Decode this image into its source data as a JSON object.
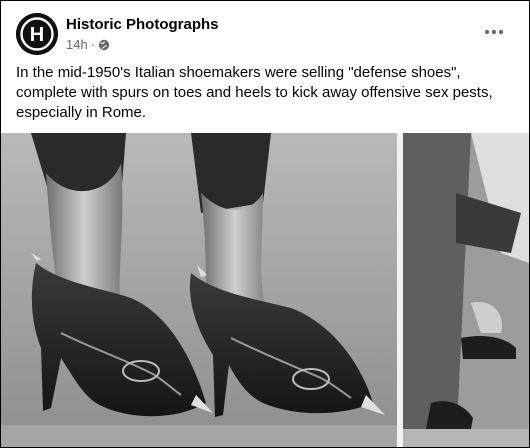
{
  "post": {
    "author": "Historic Photographs",
    "avatar_letter": "H",
    "time": "14h",
    "separator": "·",
    "privacy_icon": "globe-icon",
    "more_icon": "more-horizontal-icon",
    "caption": "In the mid-1950's Italian shoemakers were selling \"defense shoes\", complete with spurs on toes and heels to kick away offensive sex pests, especially in Rome.",
    "photo": {
      "description_icon": "vintage-photo-shoes",
      "style": "black-and-white newspaper photograph"
    }
  },
  "colors": {
    "text_primary": "#050505",
    "text_secondary": "#65676b",
    "avatar_bg": "#111111"
  }
}
